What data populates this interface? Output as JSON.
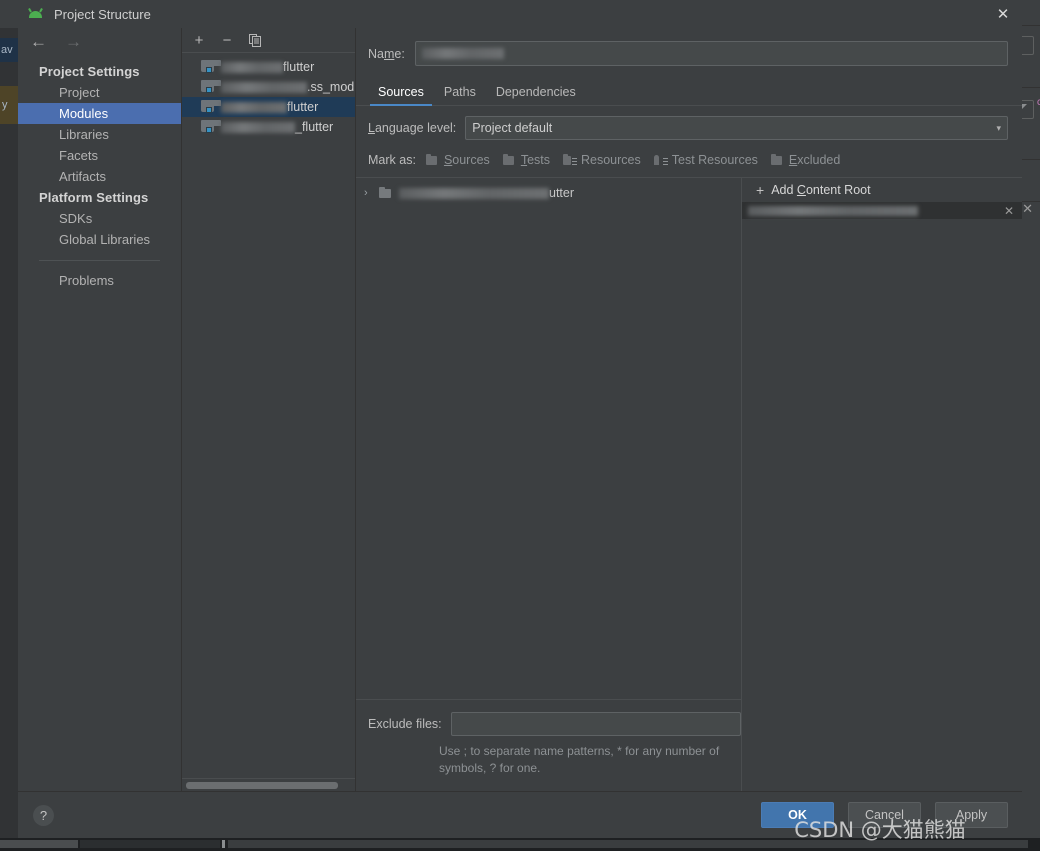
{
  "window": {
    "title": "Project Structure",
    "app_icon": "android-studio-icon",
    "close_label": "✕"
  },
  "background": {
    "left_tab_java": "av",
    "left_tab_secondary": "y",
    "right_marker": "c"
  },
  "nav": {
    "back": "←",
    "forward": "→"
  },
  "sidebar": {
    "groups": [
      {
        "label": "Project Settings",
        "items": [
          {
            "label": "Project",
            "selected": false
          },
          {
            "label": "Modules",
            "selected": true
          },
          {
            "label": "Libraries",
            "selected": false
          },
          {
            "label": "Facets",
            "selected": false
          },
          {
            "label": "Artifacts",
            "selected": false
          }
        ]
      },
      {
        "label": "Platform Settings",
        "items": [
          {
            "label": "SDKs",
            "selected": false
          },
          {
            "label": "Global Libraries",
            "selected": false
          }
        ]
      }
    ],
    "extra": [
      {
        "label": "Problems",
        "selected": false
      }
    ]
  },
  "module_list": {
    "toolbar": {
      "add": "+",
      "remove": "−",
      "copy": "copy-icon"
    },
    "items": [
      {
        "suffix": "flutter",
        "blur_width": 62,
        "selected": false
      },
      {
        "suffix": ".ss_modu",
        "blur_width": 86,
        "selected": false
      },
      {
        "suffix": "flutter",
        "blur_width": 66,
        "selected": true
      },
      {
        "suffix": "_flutter",
        "blur_width": 74,
        "selected": false
      }
    ]
  },
  "form": {
    "name_label": "Name:",
    "name_label_pre": "Na",
    "name_label_mnemonic": "m",
    "name_label_post": "e:",
    "name_value": "",
    "language_level_label": "Language level:",
    "language_level_mnemonic": "L",
    "language_level_post": "anguage level:",
    "language_level_value": "Project default",
    "caret": "▾"
  },
  "tabs": [
    {
      "label": "Sources",
      "active": true
    },
    {
      "label": "Paths",
      "active": false
    },
    {
      "label": "Dependencies",
      "active": false
    }
  ],
  "mark_as": {
    "label": "Mark as:",
    "options": [
      {
        "mnemonic": "S",
        "rest": "ources",
        "icon": "folder-sources-icon"
      },
      {
        "mnemonic": "T",
        "rest": "ests",
        "icon": "folder-tests-icon"
      },
      {
        "mnemonic": "",
        "rest": "Resources",
        "icon": "folder-resources-icon"
      },
      {
        "mnemonic": "",
        "rest": "Test Resources",
        "icon": "folder-test-resources-icon"
      },
      {
        "mnemonic": "E",
        "rest": "xcluded",
        "icon": "folder-excluded-icon"
      }
    ]
  },
  "sources_tree": {
    "chevron": "›",
    "row_suffix": "utter",
    "row_blur_width": 150
  },
  "content_root": {
    "add_label_pre": "Add ",
    "add_mnemonic": "C",
    "add_label_post": "ontent Root",
    "plus": "+",
    "entry_blur_width": 170,
    "entry_remove": "✕"
  },
  "exclude": {
    "label": "Exclude files:",
    "value": "",
    "hint": "Use ; to separate name patterns, * for any number of symbols, ? for one."
  },
  "footer": {
    "help": "?",
    "ok": "OK",
    "cancel": "Cancel",
    "apply": "Apply"
  },
  "watermark": {
    "text": "CSDN @大猫熊猫"
  },
  "colors": {
    "accent_blue": "#4b6eaf",
    "tab_underline": "#4a88c7",
    "ok_button": "#4275ad",
    "selection_row": "#1f3b57",
    "dialog_bg": "#3c3f41",
    "module_icon_blue": "#3592c4"
  }
}
